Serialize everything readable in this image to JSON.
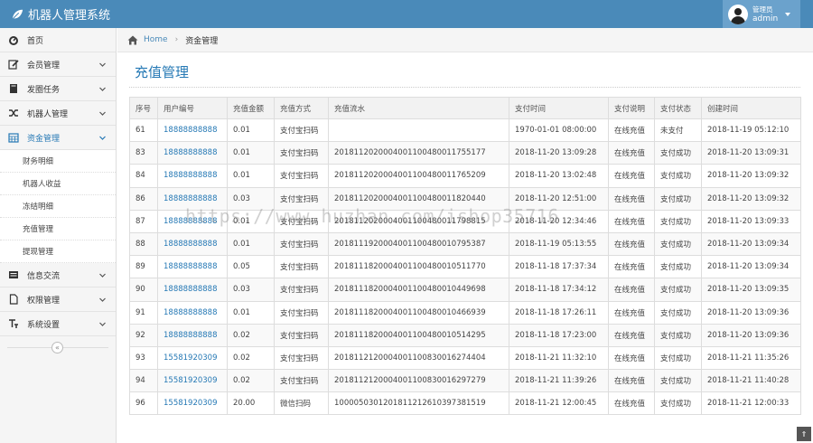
{
  "app": {
    "title": "机器人管理系统"
  },
  "user": {
    "role": "管理员",
    "name": "admin"
  },
  "sidebar": {
    "items": [
      {
        "label": "首页",
        "icon": "dashboard-icon"
      },
      {
        "label": "会员管理",
        "icon": "edit-icon"
      },
      {
        "label": "发圈任务",
        "icon": "book-icon"
      },
      {
        "label": "机器人管理",
        "icon": "shuffle-icon"
      },
      {
        "label": "资金管理",
        "icon": "calendar-icon"
      },
      {
        "label": "信息交流",
        "icon": "list-icon"
      },
      {
        "label": "权限管理",
        "icon": "file-icon"
      },
      {
        "label": "系统设置",
        "icon": "text-icon"
      }
    ],
    "subitems": [
      "财务明细",
      "机器人收益",
      "冻结明细",
      "充值管理",
      "提现管理"
    ],
    "collapse_symbol": "«"
  },
  "breadcrumb": {
    "home": "Home",
    "current": "资金管理"
  },
  "page": {
    "title": "充值管理"
  },
  "table": {
    "headers": [
      "序号",
      "用户编号",
      "充值金额",
      "充值方式",
      "充值流水",
      "支付时间",
      "支付说明",
      "支付状态",
      "创建时间"
    ],
    "rows": [
      [
        "61",
        "18888888888",
        "0.01",
        "支付宝扫码",
        "",
        "1970-01-01 08:00:00",
        "在线充值",
        "未支付",
        "2018-11-19 05:12:10"
      ],
      [
        "83",
        "18888888888",
        "0.01",
        "支付宝扫码",
        "2018112020004001100480011755177",
        "2018-11-20 13:09:28",
        "在线充值",
        "支付成功",
        "2018-11-20 13:09:31"
      ],
      [
        "84",
        "18888888888",
        "0.01",
        "支付宝扫码",
        "2018112020004001100480011765209",
        "2018-11-20 13:02:48",
        "在线充值",
        "支付成功",
        "2018-11-20 13:09:32"
      ],
      [
        "86",
        "18888888888",
        "0.03",
        "支付宝扫码",
        "2018112020004001100480011820440",
        "2018-11-20 12:51:00",
        "在线充值",
        "支付成功",
        "2018-11-20 13:09:32"
      ],
      [
        "87",
        "18888888888",
        "0.01",
        "支付宝扫码",
        "2018112020004001100480011798815",
        "2018-11-20 12:34:46",
        "在线充值",
        "支付成功",
        "2018-11-20 13:09:33"
      ],
      [
        "88",
        "18888888888",
        "0.01",
        "支付宝扫码",
        "2018111920004001100480010795387",
        "2018-11-19 05:13:55",
        "在线充值",
        "支付成功",
        "2018-11-20 13:09:34"
      ],
      [
        "89",
        "18888888888",
        "0.05",
        "支付宝扫码",
        "2018111820004001100480010511770",
        "2018-11-18 17:37:34",
        "在线充值",
        "支付成功",
        "2018-11-20 13:09:34"
      ],
      [
        "90",
        "18888888888",
        "0.03",
        "支付宝扫码",
        "2018111820004001100480010449698",
        "2018-11-18 17:34:12",
        "在线充值",
        "支付成功",
        "2018-11-20 13:09:35"
      ],
      [
        "91",
        "18888888888",
        "0.01",
        "支付宝扫码",
        "2018111820004001100480010466939",
        "2018-11-18 17:26:11",
        "在线充值",
        "支付成功",
        "2018-11-20 13:09:36"
      ],
      [
        "92",
        "18888888888",
        "0.02",
        "支付宝扫码",
        "2018111820004001100480010514295",
        "2018-11-18 17:23:00",
        "在线充值",
        "支付成功",
        "2018-11-20 13:09:36"
      ],
      [
        "93",
        "15581920309",
        "0.02",
        "支付宝扫码",
        "2018112120004001100830016274404",
        "2018-11-21 11:32:10",
        "在线充值",
        "支付成功",
        "2018-11-21 11:35:26"
      ],
      [
        "94",
        "15581920309",
        "0.02",
        "支付宝扫码",
        "2018112120004001100830016297279",
        "2018-11-21 11:39:26",
        "在线充值",
        "支付成功",
        "2018-11-21 11:40:28"
      ],
      [
        "96",
        "15581920309",
        "20.00",
        "微信扫码",
        "1000050301201811212610397381519",
        "2018-11-21 12:00:45",
        "在线充值",
        "支付成功",
        "2018-11-21 12:00:33"
      ]
    ]
  },
  "watermark": "https://www.huzhan.com/ishop35716",
  "totop": {
    "symbol": "⇑"
  },
  "colors": {
    "topbar": "#4a8ab9",
    "link": "#2679b5"
  }
}
